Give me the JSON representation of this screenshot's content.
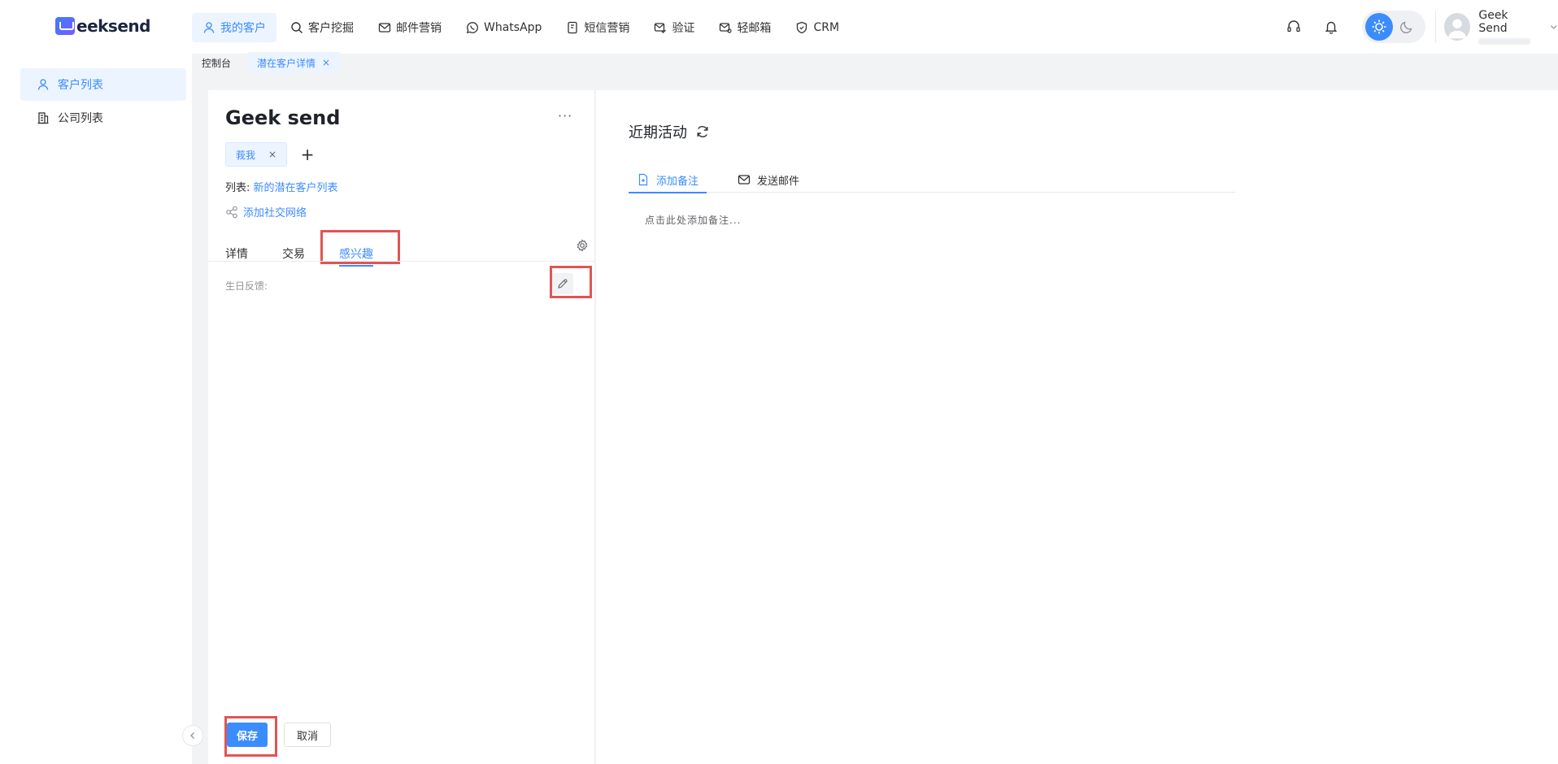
{
  "brand": {
    "logo_text": "eeksend"
  },
  "nav": [
    {
      "label": "我的客户",
      "icon": "user-icon",
      "active": true
    },
    {
      "label": "客户挖掘",
      "icon": "search-icon",
      "active": false
    },
    {
      "label": "邮件营销",
      "icon": "mail-icon",
      "active": false
    },
    {
      "label": "WhatsApp",
      "icon": "whatsapp-icon",
      "active": false
    },
    {
      "label": "短信营销",
      "icon": "sms-icon",
      "active": false
    },
    {
      "label": "验证",
      "icon": "mail-check-icon",
      "active": false
    },
    {
      "label": "轻邮箱",
      "icon": "mail-light-icon",
      "active": false
    },
    {
      "label": "CRM",
      "icon": "shield-icon",
      "active": false
    }
  ],
  "user": {
    "name": "Geek Send"
  },
  "tabstrip": [
    {
      "label": "控制台",
      "active": false
    },
    {
      "label": "潜在客户详情",
      "active": true,
      "close": "×"
    }
  ],
  "sidebar": [
    {
      "label": "客户列表",
      "icon": "user-icon",
      "active": true
    },
    {
      "label": "公司列表",
      "icon": "building-icon",
      "active": false
    }
  ],
  "customer": {
    "name": "Geek send",
    "more": "···",
    "tag": "莪我",
    "tag_close": "×",
    "add_tag": "+",
    "list_label": "列表: ",
    "list_value": "新的潜在客户列表",
    "social": "添加社交网络"
  },
  "detail_tabs": [
    {
      "label": "详情",
      "active": false
    },
    {
      "label": "交易",
      "active": false
    },
    {
      "label": "感兴趣",
      "active": true
    }
  ],
  "fields": {
    "birthday_label": "生日反馈:"
  },
  "actions": {
    "save": "保存",
    "cancel": "取消"
  },
  "activity": {
    "title": "近期活动",
    "tabs": [
      {
        "label": "添加备注",
        "icon": "note-icon",
        "active": true
      },
      {
        "label": "发送邮件",
        "icon": "mail-icon",
        "active": false
      }
    ],
    "placeholder": "点击此处添加备注..."
  },
  "colors": {
    "accent": "#3b8cff",
    "highlight": "#e15454"
  }
}
